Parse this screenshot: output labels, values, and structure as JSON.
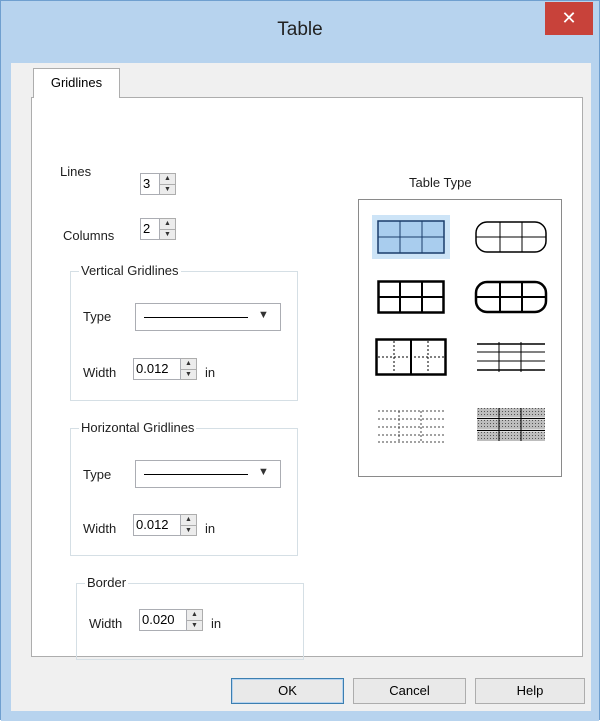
{
  "window": {
    "title": "Table",
    "close_symbol": "✕"
  },
  "tabs": [
    {
      "label": "Gridlines"
    }
  ],
  "lines": {
    "label": "Lines",
    "value": "3"
  },
  "columns": {
    "label": "Columns",
    "value": "2"
  },
  "vertical_gridlines": {
    "title": "Vertical Gridlines",
    "type_label": "Type",
    "width_label": "Width",
    "width_value": "0.012",
    "unit": "in"
  },
  "horizontal_gridlines": {
    "title": "Horizontal Gridlines",
    "type_label": "Type",
    "width_label": "Width",
    "width_value": "0.012",
    "unit": "in"
  },
  "border": {
    "title": "Border",
    "width_label": "Width",
    "width_value": "0.020",
    "unit": "in"
  },
  "table_type": {
    "label": "Table Type",
    "options": [
      {
        "name": "grid-square",
        "selected": true
      },
      {
        "name": "grid-rounded",
        "selected": false
      },
      {
        "name": "grid-square-bold",
        "selected": false
      },
      {
        "name": "grid-rounded-bold",
        "selected": false
      },
      {
        "name": "frame-dotted-inner",
        "selected": false
      },
      {
        "name": "horizontal-lines",
        "selected": false
      },
      {
        "name": "all-dotted",
        "selected": false
      },
      {
        "name": "shaded-rows",
        "selected": false
      }
    ]
  },
  "buttons": {
    "ok": "OK",
    "cancel": "Cancel",
    "help": "Help"
  },
  "colors": {
    "titlebar": "#b7d3ee",
    "close": "#c8423a",
    "selection": "#cde4f7"
  }
}
